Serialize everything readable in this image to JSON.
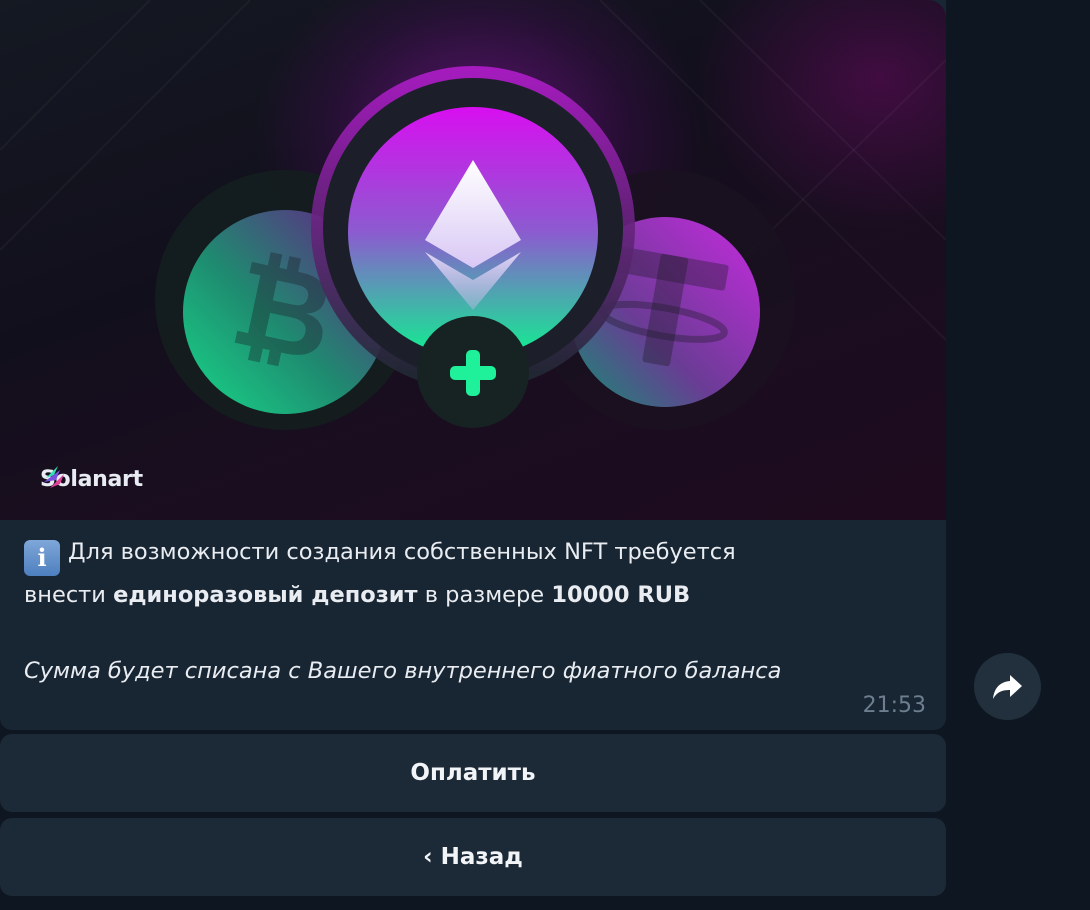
{
  "media": {
    "brand": "Solanart",
    "icons": [
      "bitcoin-icon",
      "ethereum-icon",
      "tether-icon",
      "plus-icon"
    ],
    "colors": {
      "accent_green": "#22e59a",
      "accent_purple": "#c11ce0"
    }
  },
  "message": {
    "line1": "Для возможности создания собственных NFT требуется",
    "line2_prefix": "внести ",
    "line2_bold": "единоразовый депозит",
    "line2_mid": " в размере ",
    "line2_amount": "10000 RUB",
    "italic": "Сумма будет списана с Вашего внутреннего фиатного баланса",
    "time": "21:53"
  },
  "buttons": {
    "pay": "Оплатить",
    "back": "‹ Назад"
  }
}
